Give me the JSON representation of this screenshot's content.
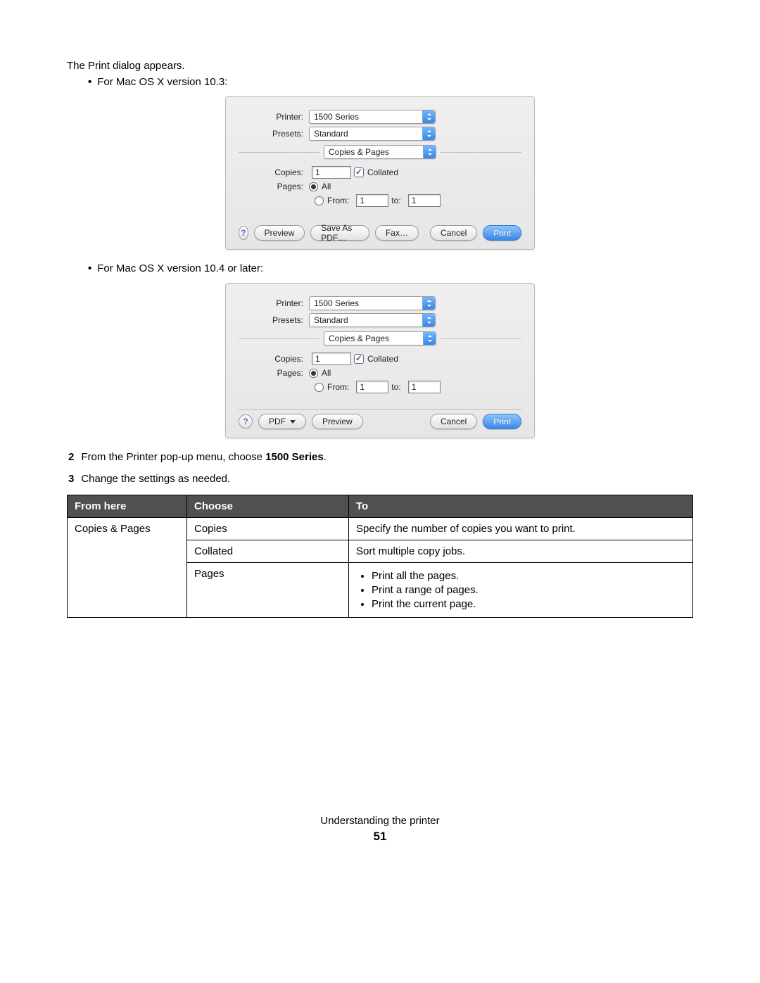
{
  "intro": "The Print dialog appears.",
  "bullet1": "For Mac OS X version 10.3:",
  "bullet2": "For Mac OS X version 10.4 or later:",
  "step2_pre": "From the Printer pop-up menu, choose ",
  "step2_bold": "1500 Series",
  "step2_post": ".",
  "step3": "Change the settings as needed.",
  "dialog": {
    "printer_label": "Printer:",
    "printer_value": "1500 Series",
    "presets_label": "Presets:",
    "presets_value": "Standard",
    "section_value": "Copies & Pages",
    "copies_label": "Copies:",
    "copies_value": "1",
    "collated": "Collated",
    "pages_label": "Pages:",
    "all": "All",
    "from": "From:",
    "from_value": "1",
    "to": "to:",
    "to_value": "1",
    "help": "?",
    "preview": "Preview",
    "save_pdf": "Save As PDF…",
    "fax": "Fax…",
    "pdf": "PDF",
    "cancel": "Cancel",
    "print": "Print"
  },
  "table": {
    "h1": "From here",
    "h2": "Choose",
    "h3": "To",
    "r1c1": "Copies & Pages",
    "r1c2": "Copies",
    "r1c3": "Specify the number of copies you want to print.",
    "r2c2": "Collated",
    "r2c3": "Sort multiple copy jobs.",
    "r3c2": "Pages",
    "r3li1": "Print all the pages.",
    "r3li2": "Print a range of pages.",
    "r3li3": "Print the current page."
  },
  "footer": {
    "title": "Understanding the printer",
    "page": "51"
  }
}
